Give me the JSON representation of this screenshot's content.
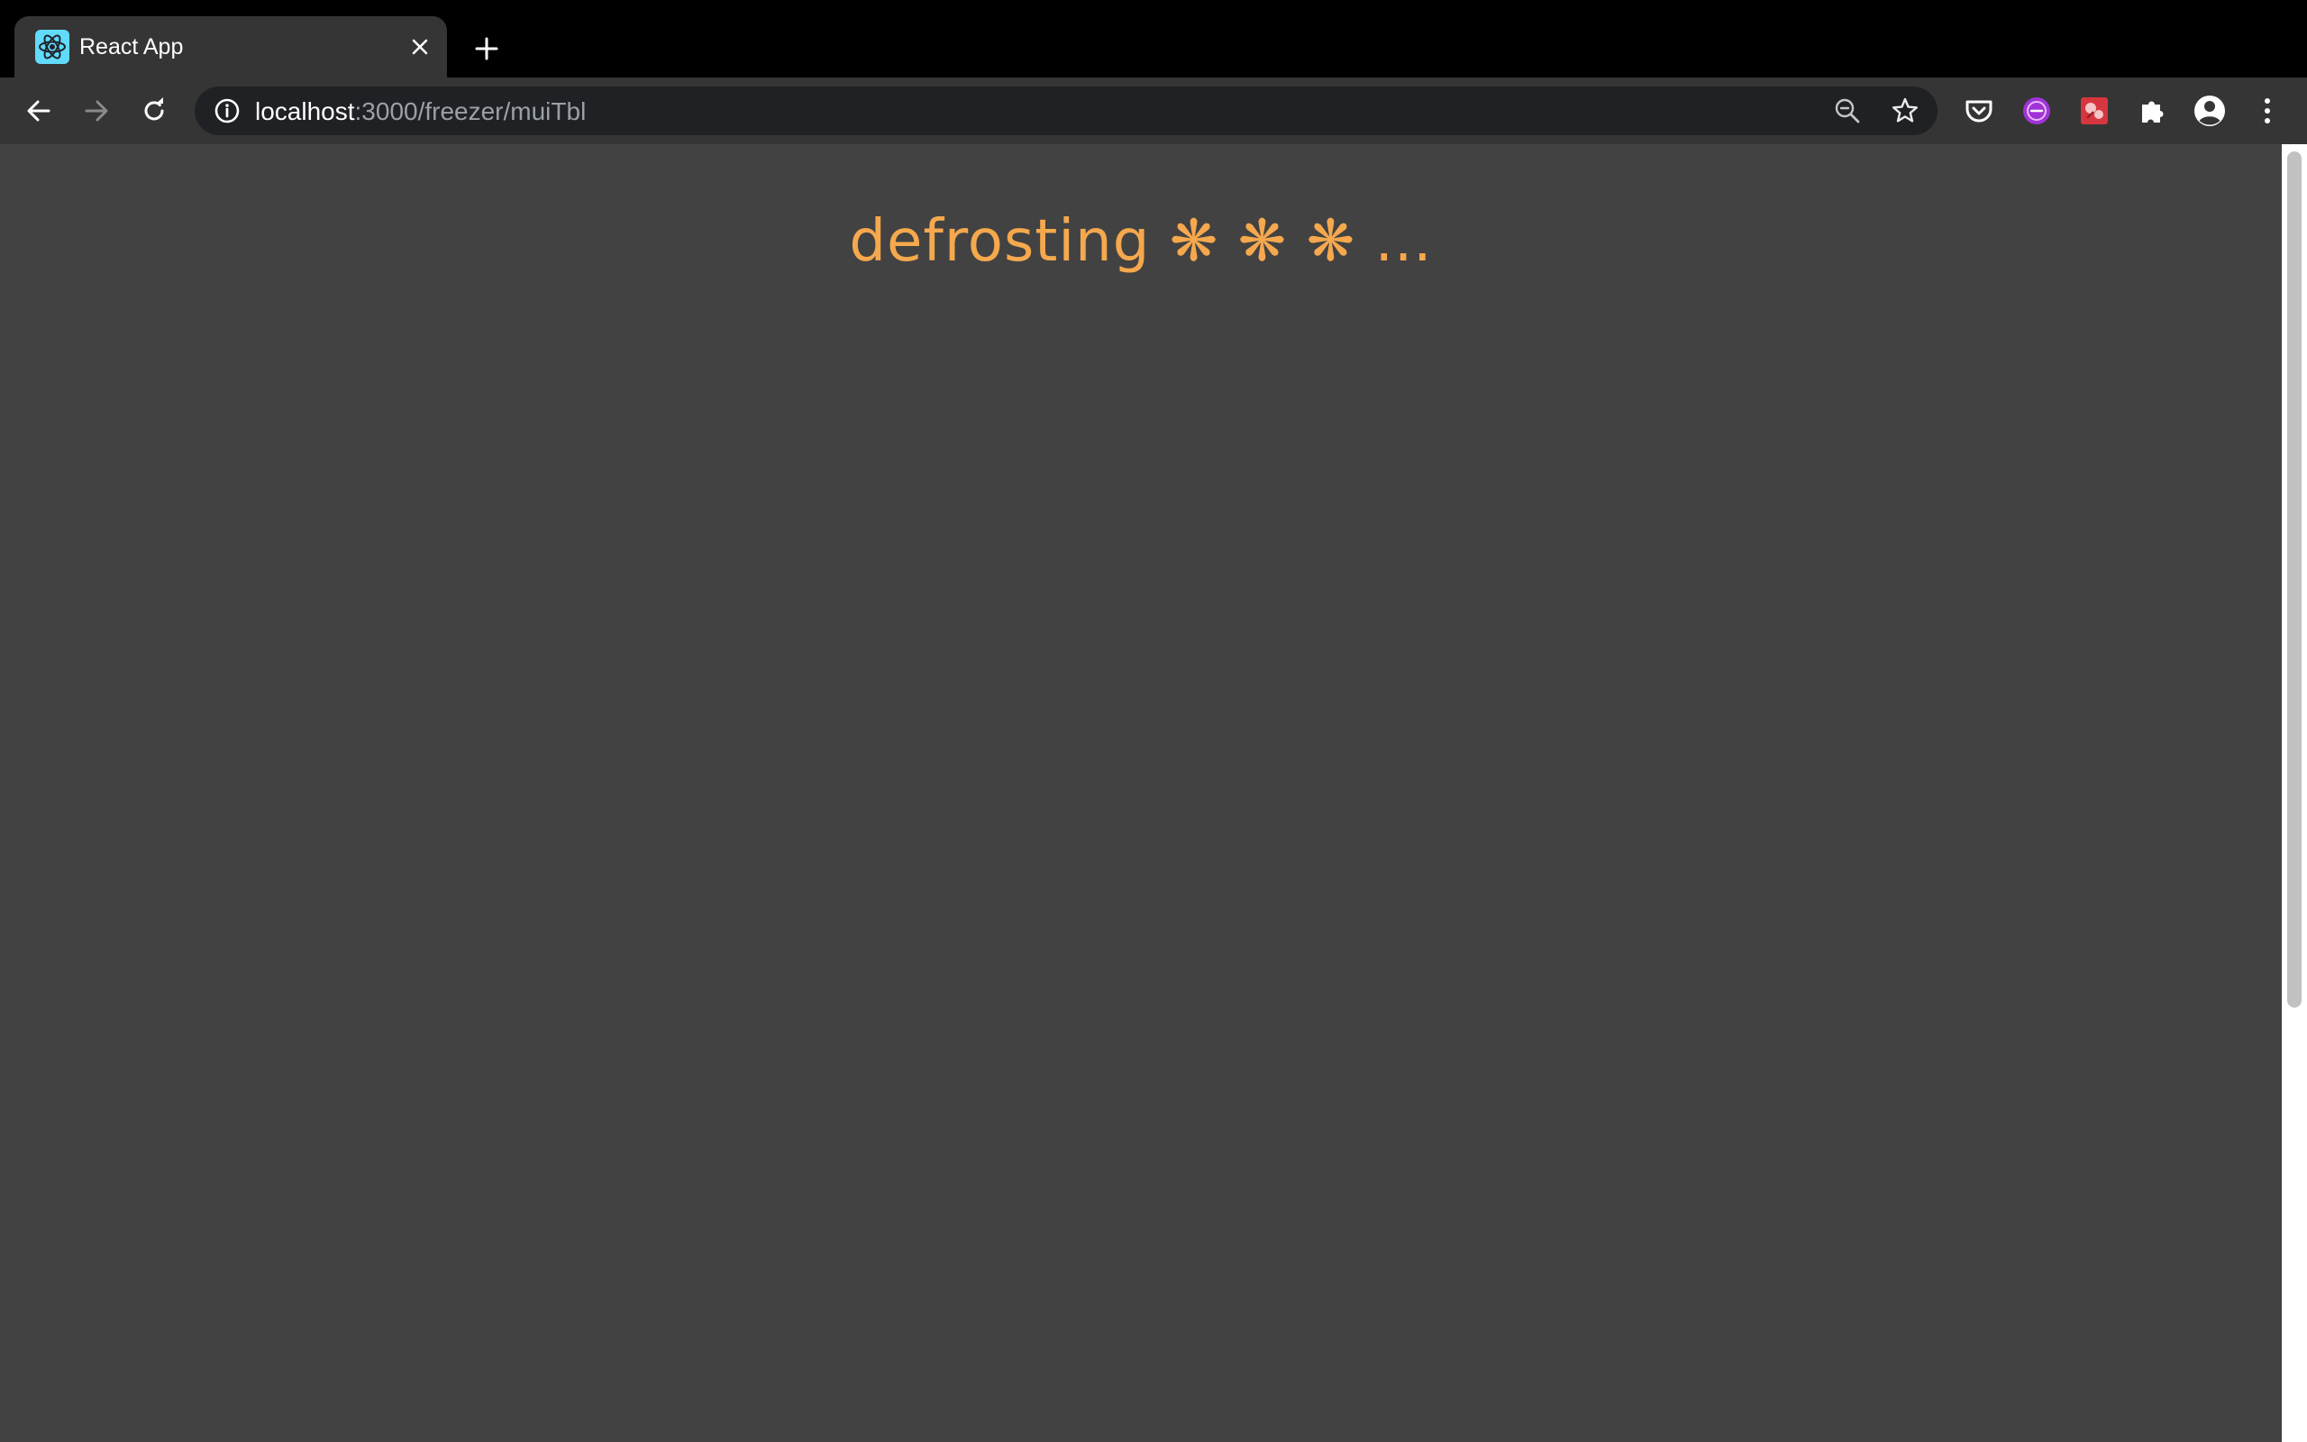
{
  "tab": {
    "title": "React App",
    "favicon": "react-logo-icon"
  },
  "toolbar": {
    "url_host": "localhost",
    "url_path": ":3000/freezer/muiTbl"
  },
  "page": {
    "status_text": "defrosting ❋ ❋ ❋ ..."
  },
  "colors": {
    "page_background": "#424242",
    "status_text": "#f5a84d",
    "toolbar_background": "#353535",
    "omnibox_background": "#202124"
  },
  "icons": {
    "extensions": [
      "pocket-icon",
      "purple-extension-icon",
      "red-extension-icon",
      "puzzle-icon"
    ]
  }
}
